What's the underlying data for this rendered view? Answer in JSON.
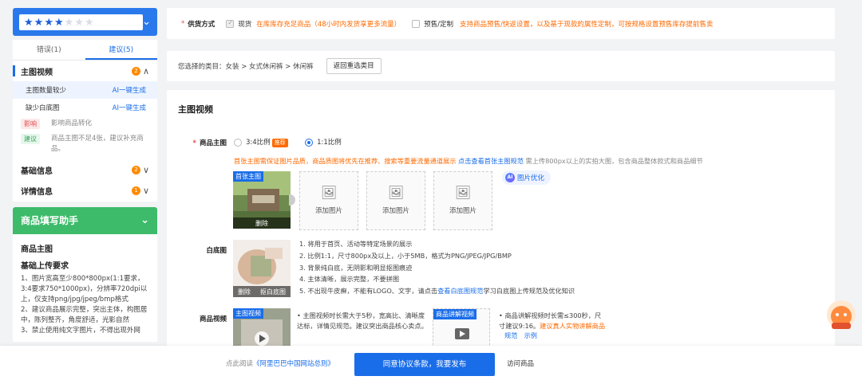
{
  "colors": {
    "accent": "#1a6de8",
    "warning": "#ff6a00",
    "helper": "#3dbb6a"
  },
  "score": {
    "stars_on": 4,
    "stars_total": 7,
    "chevron_icon": "chevron-down-icon"
  },
  "tabs": [
    {
      "label": "错误(1)"
    },
    {
      "label": "建议(5)"
    }
  ],
  "checklist": {
    "main_video": {
      "title": "主图视频",
      "count": "2"
    },
    "items": [
      {
        "label": "主图数量较少",
        "action": "AI一键生成"
      },
      {
        "label": "缺少白底图",
        "action": "AI一键生成"
      }
    ],
    "impact": {
      "tag": "影响",
      "text": "影响商品转化"
    },
    "suggest": {
      "tag": "建议",
      "text": "商品主图不足4张，建议补充商品。"
    },
    "basic": {
      "title": "基础信息",
      "count": "2"
    },
    "detail": {
      "title": "详情信息",
      "count": "1"
    }
  },
  "helper": {
    "title": "商品填写助手",
    "h1": "商品主图",
    "h2": "基础上传要求",
    "lines": [
      "1、图片宽高至少800*800px(1:1要求，3:4要求750*1000px)，分辨率720dpi以上，仅支持png/jpg/jpeg/bmp格式",
      "2、建议商品展示完整，突出主体，构图居中，陈列整齐，角度舒适，光影自然",
      "3、禁止使用纯文字图片，不得出现外网"
    ]
  },
  "supply": {
    "label": "供货方式",
    "opt1": "现货",
    "opt1_desc": "在库库存充足商品（48小时内发货享更多流量）",
    "opt2": "预售/定制",
    "opt2_desc": "支持商品预售/快返设置，以及基于现款的属性定制，可按规格设置预售库存提前售卖"
  },
  "category": {
    "prefix": "您选择的类目：",
    "path": "女装 > 女式休闲裤 > 休闲裤",
    "button": "返回重选类目"
  },
  "main_section": {
    "title": "主图视频",
    "main_img_label": "商品主图",
    "ratio1": "3:4比例",
    "ratio1_tag": "推荐",
    "ratio2": "1:1比例",
    "notice_orange": "首张主图需保证图片品质，商品质图将优先在推荐、搜索等重要流量通道展示",
    "notice_link": "点击查看首张主图规范",
    "notice_gray": "需上传800px以上的实拍大图，包含商品整体款式和商品细节",
    "first_tag": "首张主图",
    "delete": "删除",
    "add_img": "添加图片",
    "ai_btn": "图片优化",
    "white_label": "白底图",
    "white_delete": "删除",
    "white_cutout": "抠白底图",
    "white_rules": [
      "1. 将用于首页、活动等特定场景的展示",
      "2. 比例1:1，尺寸800px及以上，小于5MB，格式为PNG/JPEG/JPG/BMP",
      "3. 背景纯白底，无阴影和明显抠图痕迹",
      "4. 主体清晰，展示完整，不要拼图",
      "5. 不出现牛皮癣，不能有LOGO、文字，请点击",
      "查看白底图规范",
      "学习白底图上传规范及优化知识"
    ],
    "video_label": "商品视频",
    "video_tag": "主图视频",
    "video_desc": "主图视频时长需大于5秒，宽高比、清晰度达标，详情见规范。建议突出商品核心卖点。",
    "explain_tag": "商品讲解视频",
    "explain_desc": "商品讲解视频时长需≤300秒，尺寸建议9:16。",
    "explain_link": "建议真人实物讲解商品",
    "explain_link2": "规范",
    "explain_link3": "示例"
  },
  "footer": {
    "agree_prefix": "点此阅读",
    "agree_link": "《阿里巴巴中国网站总则》",
    "submit": "同意协议条款，我要发布",
    "visit": "访问商品"
  }
}
